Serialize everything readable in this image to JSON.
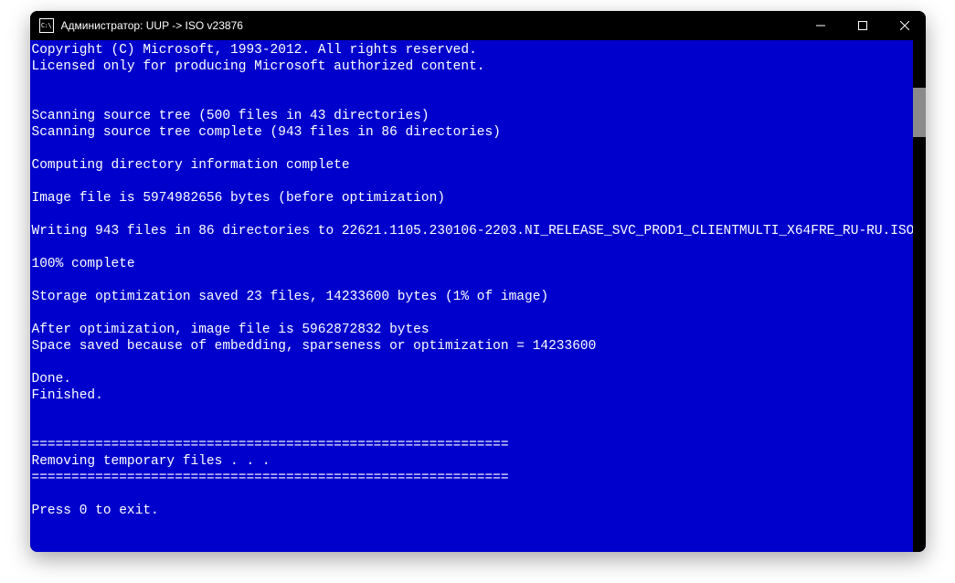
{
  "titlebar": {
    "prefix": "Администратор:  ",
    "title": "UUP -> ISO v23876"
  },
  "console": {
    "lines": [
      "Copyright (C) Microsoft, 1993-2012. All rights reserved.",
      "Licensed only for producing Microsoft authorized content.",
      "",
      "",
      "Scanning source tree (500 files in 43 directories)",
      "Scanning source tree complete (943 files in 86 directories)",
      "",
      "Computing directory information complete",
      "",
      "Image file is 5974982656 bytes (before optimization)",
      "",
      "Writing 943 files in 86 directories to 22621.1105.230106-2203.NI_RELEASE_SVC_PROD1_CLIENTMULTI_X64FRE_RU-RU.ISO",
      "",
      "100% complete",
      "",
      "Storage optimization saved 23 files, 14233600 bytes (1% of image)",
      "",
      "After optimization, image file is 5962872832 bytes",
      "Space saved because of embedding, sparseness or optimization = 14233600",
      "",
      "Done.",
      "Finished.",
      "",
      "",
      "============================================================",
      "Removing temporary files . . .",
      "============================================================",
      "",
      "Press 0 to exit."
    ]
  }
}
